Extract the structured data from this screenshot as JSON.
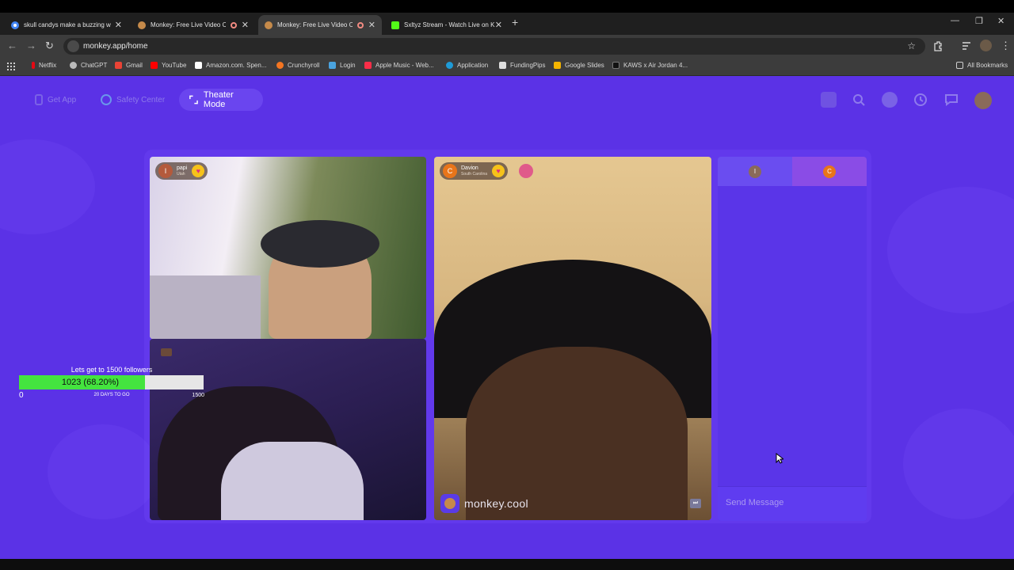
{
  "browser": {
    "tabs": [
      {
        "title": "skull candys make a buzzing w",
        "favicon": "google-icon",
        "active": false,
        "recording": false
      },
      {
        "title": "Monkey: Free Live Video Ch",
        "favicon": "monkey-icon",
        "active": false,
        "recording": true
      },
      {
        "title": "Monkey: Free Live Video Ch",
        "favicon": "monkey-icon",
        "active": true,
        "recording": true
      },
      {
        "title": "Sxltyz Stream - Watch Live on K",
        "favicon": "kick-icon",
        "active": false,
        "recording": false
      }
    ],
    "url": "monkey.app/home",
    "bookmarks": [
      "Netflix",
      "ChatGPT",
      "Gmail",
      "YouTube",
      "Amazon.com. Spen...",
      "Crunchyroll",
      "Login",
      "Apple Music - Web...",
      "Application",
      "FundingPips",
      "Google Slides",
      "KAWS x Air Jordan 4..."
    ],
    "all_bookmarks_label": "All Bookmarks"
  },
  "app": {
    "nav": {
      "get_app": "Get App",
      "safety_center": "Safety Center",
      "theater_mode": "Theater Mode"
    },
    "participants": [
      {
        "initial": "I",
        "name": "papi",
        "location": "Utah",
        "avatar_color": "#b45a3c"
      },
      {
        "initial": "C",
        "name": "Davion",
        "location": "South Carolina",
        "avatar_color": "#e8751a"
      }
    ],
    "chat": {
      "tab_initials": [
        "I",
        "C"
      ],
      "placeholder": "Send Message"
    },
    "watermark": "monkey.cool"
  },
  "overlay": {
    "goal_title": "Lets get to 1500 followers",
    "current_label": "1023 (68.20%)",
    "progress": 0.682,
    "min": "0",
    "max": "1500",
    "days_left": "20 DAYS TO GO"
  },
  "colors": {
    "page_bg": "#5b32e6",
    "progress_fill": "#44e43f",
    "accent": "#6a45ef"
  }
}
